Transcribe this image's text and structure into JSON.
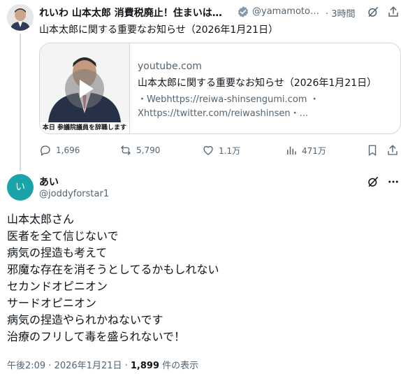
{
  "quoted_tweet": {
    "display_name": "れいわ 山本太郎 消費税廃止！住まいは…",
    "handle": "@yamamotot…",
    "time": "· 3時間",
    "text": "山本太郎に関する重要なお知らせ（2026年1月21日）",
    "card": {
      "thumbnail_caption": "本日 参議院議員を辞職します",
      "domain": "youtube.com",
      "title": "山本太郎に関する重要なお知らせ（2026年1月21日）",
      "desc_line1": "・Webhttps://reiwa-shinsengumi.com ・",
      "desc_line2": "Xhttps://twitter.com/reiwashinsen・..."
    },
    "actions": {
      "replies": "1,696",
      "reposts": "5,790",
      "likes": "1.1万",
      "views": "471万"
    }
  },
  "reply": {
    "avatar_letter": "い",
    "avatar_color": "#1aa3a9",
    "display_name": "あい",
    "handle": "@joddyforstar1",
    "lines": [
      "山本太郎さん",
      "医者を全て信じないで",
      "病気の捏造も考えて",
      "邪魔な存在を消そうとしてるかもしれない",
      "セカンドオピニオン",
      "サードオピニオン",
      "病気の捏造やられかねないです",
      "治療のフリして毒を盛られないで！"
    ],
    "timestamp": "午後2:09 · 2026年1月21日 · ",
    "view_count": "1,899",
    "view_suffix": " 件の表示"
  },
  "colors": {
    "verified": "#829aab",
    "secondary_text": "#536471",
    "border": "#cfd9de"
  }
}
